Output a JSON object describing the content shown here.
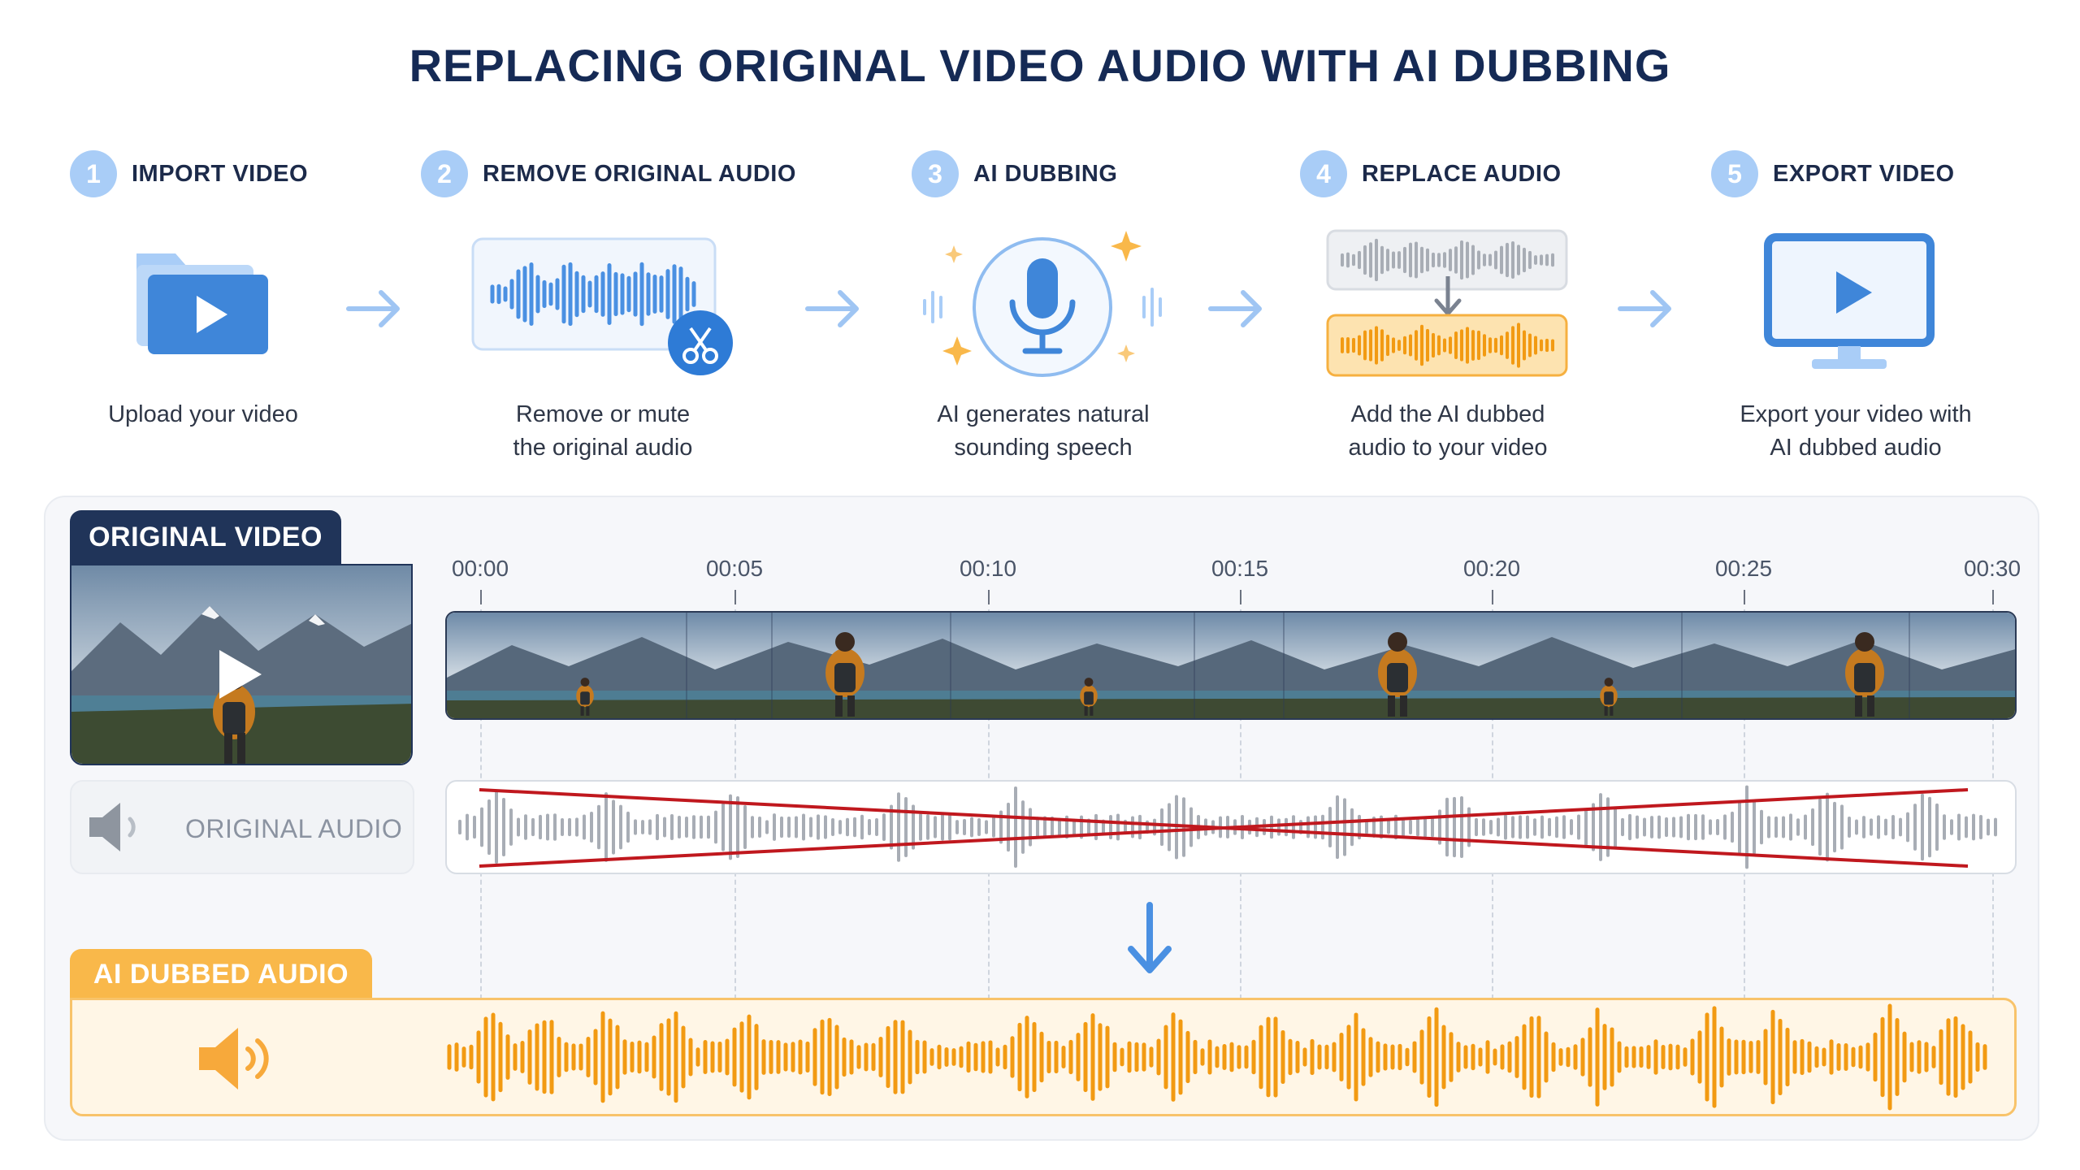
{
  "title": "REPLACING ORIGINAL VIDEO AUDIO WITH AI DUBBING",
  "steps": [
    {
      "num": "1",
      "title": "IMPORT VIDEO",
      "desc": [
        "Upload your video"
      ],
      "icon": "folder-video-icon"
    },
    {
      "num": "2",
      "title": "REMOVE ORIGINAL AUDIO",
      "desc": [
        "Remove or mute",
        "the original audio"
      ],
      "icon": "audio-cut-icon"
    },
    {
      "num": "3",
      "title": "AI DUBBING",
      "desc": [
        "AI generates natural",
        "sounding speech"
      ],
      "icon": "microphone-sparkle-icon"
    },
    {
      "num": "4",
      "title": "REPLACE AUDIO",
      "desc": [
        "Add the AI dubbed",
        "audio to your video"
      ],
      "icon": "replace-waveform-icon"
    },
    {
      "num": "5",
      "title": "EXPORT VIDEO",
      "desc": [
        "Export your video with",
        "AI dubbed audio"
      ],
      "icon": "monitor-play-icon"
    }
  ],
  "timeline": {
    "original_video_label": "ORIGINAL VIDEO",
    "original_audio_label": "ORIGINAL AUDIO",
    "ai_audio_label": "AI DUBBED AUDIO",
    "times": [
      "00:00",
      "00:05",
      "00:10",
      "00:15",
      "00:20",
      "00:25",
      "00:30"
    ]
  },
  "colors": {
    "accent_blue": "#4a90e2",
    "dark_navy": "#203459",
    "ai_orange": "#f9b84a",
    "cross_red": "#c0181e",
    "muted_gray": "#a8adb5"
  }
}
